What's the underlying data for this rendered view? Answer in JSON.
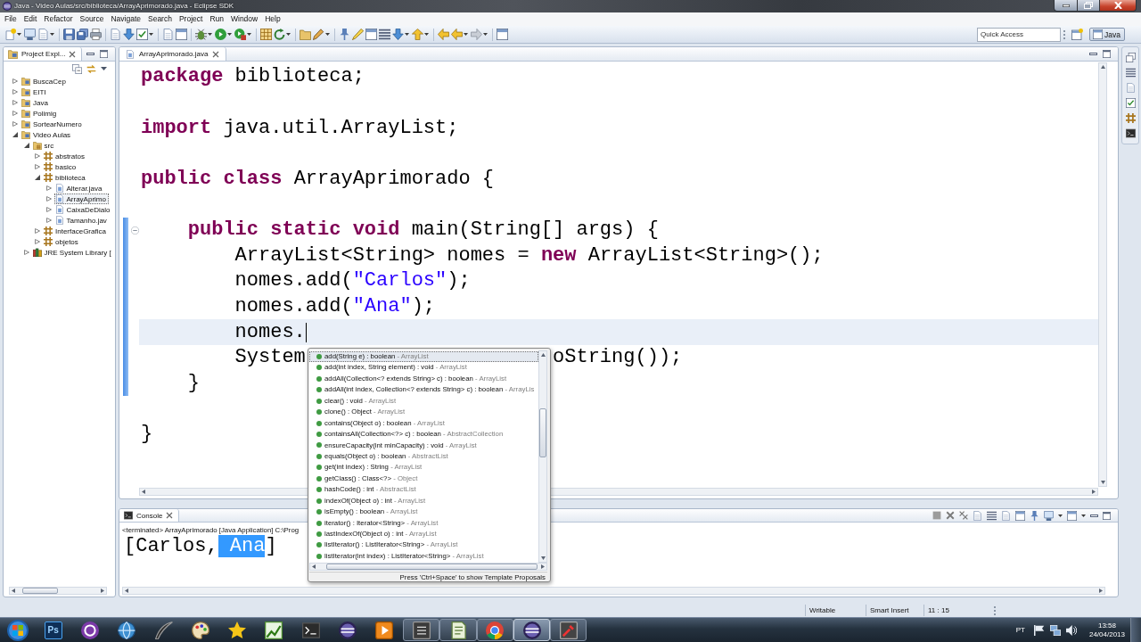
{
  "window": {
    "title": "Java - Video Aulas/src/biblioteca/ArrayAprimorado.java - Eclipse SDK"
  },
  "menu": [
    "File",
    "Edit",
    "Refactor",
    "Source",
    "Navigate",
    "Search",
    "Project",
    "Run",
    "Window",
    "Help"
  ],
  "toolbar": {
    "quick_access": {
      "placeholder": "Quick Access"
    },
    "perspective": {
      "label": "Java",
      "selected": true
    }
  },
  "project_explorer": {
    "title": "Project Expl...",
    "tree": [
      {
        "label": "BuscaCep",
        "kind": "project",
        "expanded": false,
        "selected": false
      },
      {
        "label": "EITI",
        "kind": "project",
        "expanded": false,
        "selected": false
      },
      {
        "label": "Java",
        "kind": "project",
        "expanded": false,
        "selected": false
      },
      {
        "label": "Polimig",
        "kind": "project",
        "expanded": false,
        "selected": false
      },
      {
        "label": "SortearNumero",
        "kind": "project",
        "expanded": false,
        "selected": false
      },
      {
        "label": "Video Aulas",
        "kind": "project",
        "expanded": true,
        "selected": false,
        "children": [
          {
            "label": "src",
            "kind": "source-folder",
            "expanded": true,
            "selected": false,
            "children": [
              {
                "label": "abstratos",
                "kind": "package",
                "expanded": false,
                "selected": false
              },
              {
                "label": "basico",
                "kind": "package",
                "expanded": false,
                "selected": false
              },
              {
                "label": "biblioteca",
                "kind": "package",
                "expanded": true,
                "selected": false,
                "children": [
                  {
                    "label": "Alterar.java",
                    "kind": "java-file",
                    "expanded": false,
                    "selected": false
                  },
                  {
                    "label": "ArrayAprimo",
                    "kind": "java-file",
                    "expanded": false,
                    "selected": true
                  },
                  {
                    "label": "CaixaDeDialo",
                    "kind": "java-file",
                    "expanded": false,
                    "selected": false
                  },
                  {
                    "label": "Tamanho.jav",
                    "kind": "java-file",
                    "expanded": false,
                    "selected": false
                  }
                ]
              },
              {
                "label": "InterfaceGrafica",
                "kind": "package",
                "expanded": false,
                "selected": false
              },
              {
                "label": "objetos",
                "kind": "package",
                "expanded": false,
                "selected": false
              }
            ]
          },
          {
            "label": "JRE System Library [",
            "kind": "library",
            "expanded": false,
            "selected": false
          }
        ]
      }
    ]
  },
  "editor": {
    "tab": "ArrayAprimorado.java",
    "lines": [
      {
        "kind": "code",
        "current": false,
        "tokens": [
          {
            "kind": "keyword",
            "text": "package"
          },
          {
            "kind": "plain",
            "text": " biblioteca;"
          }
        ]
      },
      {
        "kind": "blank",
        "current": false
      },
      {
        "kind": "code",
        "current": false,
        "tokens": [
          {
            "kind": "keyword",
            "text": "import"
          },
          {
            "kind": "plain",
            "text": " java.util.ArrayList;"
          }
        ]
      },
      {
        "kind": "blank",
        "current": false
      },
      {
        "kind": "code",
        "current": false,
        "tokens": [
          {
            "kind": "keyword",
            "text": "public class"
          },
          {
            "kind": "plain",
            "text": " ArrayAprimorado {"
          }
        ],
        "children": [
          {
            "kind": "blank",
            "current": false
          },
          {
            "kind": "code",
            "current": false,
            "tokens": [
              {
                "kind": "keyword",
                "text": "public static void"
              },
              {
                "kind": "plain",
                "text": " main(String[] args) {"
              }
            ],
            "children": [
              {
                "kind": "code",
                "current": false,
                "tokens": [
                  {
                    "kind": "plain",
                    "text": "ArrayList<String> nomes = "
                  },
                  {
                    "kind": "keyword",
                    "text": "new"
                  },
                  {
                    "kind": "plain",
                    "text": " ArrayList<String>();"
                  }
                ]
              },
              {
                "kind": "code",
                "current": false,
                "tokens": [
                  {
                    "kind": "plain",
                    "text": "nomes.add("
                  },
                  {
                    "kind": "string",
                    "text": "\"Carlos\""
                  },
                  {
                    "kind": "plain",
                    "text": ");"
                  }
                ]
              },
              {
                "kind": "code",
                "current": false,
                "tokens": [
                  {
                    "kind": "plain",
                    "text": "nomes.add("
                  },
                  {
                    "kind": "string",
                    "text": "\"Ana\""
                  },
                  {
                    "kind": "plain",
                    "text": ");"
                  }
                ]
              },
              {
                "kind": "code",
                "current": true,
                "tokens": [
                  {
                    "kind": "plain",
                    "text": "nomes."
                  }
                ]
              },
              {
                "kind": "code",
                "current": false,
                "tokens": [
                  {
                    "kind": "plain",
                    "text": "System"
                  },
                  {
                    "kind": "gap"
                  },
                  {
                    "kind": "plain",
                    "text": "oString());"
                  }
                ]
              }
            ]
          },
          {
            "kind": "code",
            "current": false,
            "tokens": [
              {
                "kind": "plain",
                "text": "}"
              }
            ]
          },
          {
            "kind": "blank",
            "current": false
          }
        ]
      },
      {
        "kind": "code",
        "current": false,
        "tokens": [
          {
            "kind": "plain",
            "text": "}"
          }
        ]
      }
    ]
  },
  "completion": {
    "items": [
      {
        "signature": "add(String e) : boolean",
        "qualifier": "- ArrayList",
        "selected": true
      },
      {
        "signature": "add(int index, String element) : void",
        "qualifier": "- ArrayList",
        "selected": false
      },
      {
        "signature": "addAll(Collection<? extends String> c) : boolean",
        "qualifier": "- ArrayList",
        "selected": false
      },
      {
        "signature": "addAll(int index, Collection<? extends String> c) : boolean",
        "qualifier": "- ArrayLis",
        "selected": false
      },
      {
        "signature": "clear() : void",
        "qualifier": "- ArrayList",
        "selected": false
      },
      {
        "signature": "clone() : Object",
        "qualifier": "- ArrayList",
        "selected": false
      },
      {
        "signature": "contains(Object o) : boolean",
        "qualifier": "- ArrayList",
        "selected": false
      },
      {
        "signature": "containsAll(Collection<?> c) : boolean",
        "qualifier": "- AbstractCollection",
        "selected": false
      },
      {
        "signature": "ensureCapacity(int minCapacity) : void",
        "qualifier": "- ArrayList",
        "selected": false
      },
      {
        "signature": "equals(Object o) : boolean",
        "qualifier": "- AbstractList",
        "selected": false
      },
      {
        "signature": "get(int index) : String",
        "qualifier": "- ArrayList",
        "selected": false
      },
      {
        "signature": "getClass() : Class<?>",
        "qualifier": "- Object",
        "selected": false
      },
      {
        "signature": "hashCode() : int",
        "qualifier": "- AbstractList",
        "selected": false
      },
      {
        "signature": "indexOf(Object o) : int",
        "qualifier": "- ArrayList",
        "selected": false
      },
      {
        "signature": "isEmpty() : boolean",
        "qualifier": "- ArrayList",
        "selected": false
      },
      {
        "signature": "iterator() : Iterator<String>",
        "qualifier": "- ArrayList",
        "selected": false
      },
      {
        "signature": "lastIndexOf(Object o) : int",
        "qualifier": "- ArrayList",
        "selected": false
      },
      {
        "signature": "listIterator() : ListIterator<String>",
        "qualifier": "- ArrayList",
        "selected": false
      },
      {
        "signature": "listIterator(int index) : ListIterator<String>",
        "qualifier": "- ArrayList",
        "selected": false
      }
    ],
    "footer": "Press 'Ctrl+Space' to show Template Proposals"
  },
  "console": {
    "tab": "Console",
    "header": "<terminated> ArrayAprimorado [Java Application] C:\\Prog",
    "output": [
      {
        "text": "[Carlos,",
        "selected": false
      },
      {
        "text": " Ana",
        "selected": true
      },
      {
        "text": "]",
        "selected": false
      }
    ]
  },
  "status_bar": {
    "write_mode": "Writable",
    "insert_mode": "Smart Insert",
    "cursor_position": "11 : 15"
  },
  "taskbar": {
    "buttons": [
      {
        "label": "Ps",
        "open": false,
        "selected": false
      },
      {
        "open": false,
        "selected": false
      },
      {
        "open": false,
        "selected": false
      },
      {
        "open": false,
        "selected": false
      },
      {
        "open": false,
        "selected": false
      },
      {
        "open": false,
        "selected": false
      },
      {
        "open": false,
        "selected": false
      },
      {
        "open": false,
        "selected": false
      },
      {
        "open": false,
        "selected": false
      },
      {
        "open": false,
        "selected": false
      },
      {
        "open": true,
        "selected": false
      },
      {
        "open": true,
        "selected": false
      },
      {
        "open": true,
        "selected": false
      },
      {
        "open": true,
        "selected": true
      },
      {
        "open": true,
        "selected": false
      }
    ],
    "language": "PT",
    "time": "13:58",
    "date": "24/04/2013"
  }
}
